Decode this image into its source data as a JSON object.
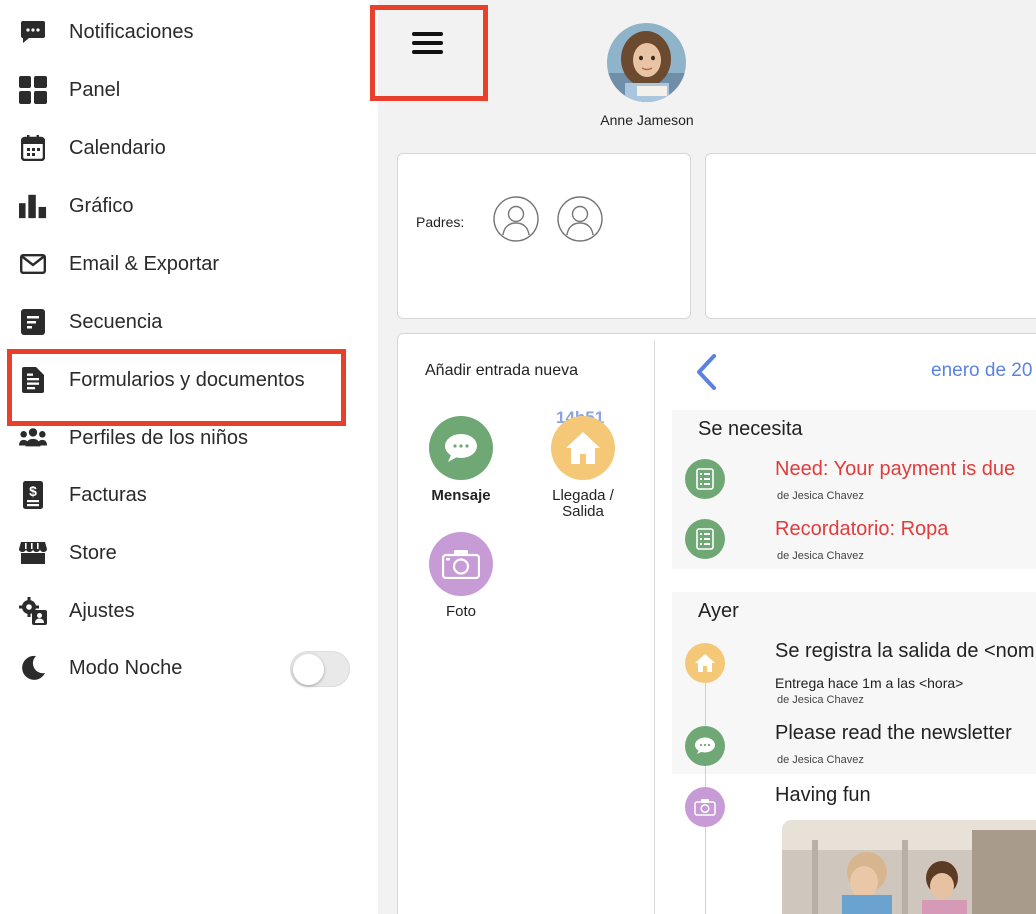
{
  "sidebar": {
    "items": [
      {
        "label": "Notificaciones",
        "icon": "chat-bubble-icon"
      },
      {
        "label": "Panel",
        "icon": "dashboard-grid-icon"
      },
      {
        "label": "Calendario",
        "icon": "calendar-icon"
      },
      {
        "label": "Gráfico",
        "icon": "bar-chart-icon"
      },
      {
        "label": "Email & Exportar",
        "icon": "envelope-icon"
      },
      {
        "label": "Secuencia",
        "icon": "sequence-icon"
      },
      {
        "label": "Formularios y documentos",
        "icon": "document-icon"
      },
      {
        "label": "Perfiles de los niños",
        "icon": "people-group-icon"
      },
      {
        "label": "Facturas",
        "icon": "invoice-dollar-icon"
      },
      {
        "label": "Store",
        "icon": "store-icon"
      },
      {
        "label": "Ajustes",
        "icon": "settings-gear-icon"
      },
      {
        "label": "Modo Noche",
        "icon": "moon-icon"
      }
    ],
    "night_mode_on": false
  },
  "header": {
    "child_name": "Anne Jameson"
  },
  "parents": {
    "label": "Padres:"
  },
  "add_entry": {
    "title": "Añadir entrada nueva",
    "actions": [
      {
        "label": "Mensaje",
        "color": "#6fa874"
      },
      {
        "label": "Llegada /\nSalida",
        "color": "#f5c878",
        "time": "14h51"
      },
      {
        "label": "Foto",
        "color": "#c69bd6"
      }
    ]
  },
  "feed": {
    "month": "enero de 20",
    "sections": [
      {
        "title": "Se necesita",
        "entries": [
          {
            "title": "Need: Your payment is due",
            "by": "de Jesica Chavez"
          },
          {
            "title": "Recordatorio: Ropa",
            "by": "de Jesica Chavez"
          }
        ]
      },
      {
        "title": "Ayer",
        "entries": [
          {
            "title": "Se registra la salida de <nom",
            "detail": "Entrega hace 1m a las <hora>",
            "by": "de Jesica Chavez"
          },
          {
            "title": "Please read the newsletter",
            "by": "de Jesica Chavez"
          },
          {
            "title": "Having fun"
          }
        ]
      }
    ]
  },
  "colors": {
    "accent_red": "#e23b3b",
    "highlight": "#e8402a",
    "link_blue": "#5b82e0",
    "message_green": "#6fa874",
    "checkin_orange": "#f5c878",
    "photo_purple": "#c69bd6"
  }
}
